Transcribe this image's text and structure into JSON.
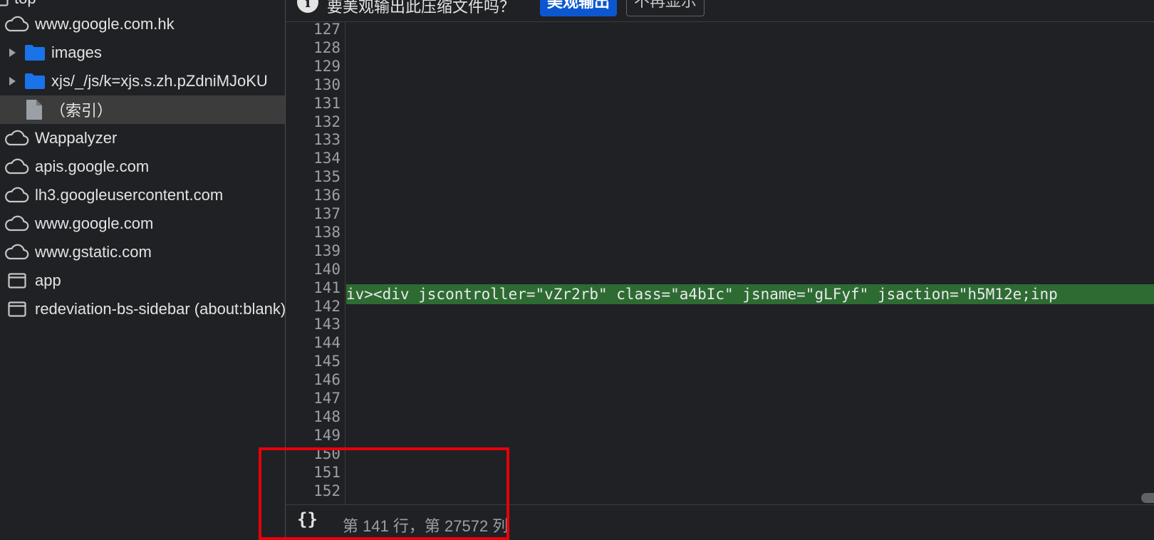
{
  "tree": {
    "top_label": "top",
    "items": [
      {
        "label": "www.google.com.hk",
        "icon": "cloud-icon"
      },
      {
        "label": "images",
        "icon": "folder-icon"
      },
      {
        "label": "xjs/_/js/k=xjs.s.zh.pZdniMJoKU",
        "icon": "folder-icon"
      },
      {
        "label": "（索引）",
        "icon": "file-icon"
      },
      {
        "label": "Wappalyzer",
        "icon": "cloud-icon"
      },
      {
        "label": "apis.google.com",
        "icon": "cloud-icon"
      },
      {
        "label": "lh3.googleusercontent.com",
        "icon": "cloud-icon"
      },
      {
        "label": "www.google.com",
        "icon": "cloud-icon"
      },
      {
        "label": "www.gstatic.com",
        "icon": "cloud-icon"
      },
      {
        "label": "app",
        "icon": "frame-icon"
      },
      {
        "label": "redeviation-bs-sidebar (about:blank)",
        "icon": "frame-icon"
      }
    ]
  },
  "infobar": {
    "message": "要美观输出此压缩文件吗？",
    "pretty_print_label": "美观输出",
    "never_show_label": "不再显示"
  },
  "editor": {
    "line_numbers": [
      "127",
      "128",
      "129",
      "130",
      "131",
      "132",
      "133",
      "134",
      "135",
      "136",
      "137",
      "138",
      "139",
      "140",
      "141",
      "142",
      "143",
      "144",
      "145",
      "146",
      "147",
      "148",
      "149",
      "150",
      "151",
      "152"
    ],
    "highlighted_line": "iv><div jscontroller=\"vZr2rb\" class=\"a4bIc\" jsname=\"gLFyf\" jsaction=\"h5M12e;inp"
  },
  "statusbar": {
    "pretty_print_symbol": "{}",
    "cursor_position": "第 141 行，第 27572 列"
  },
  "colors": {
    "background": "#202124",
    "highlight_line": "#2e6b32",
    "accent_button": "#0b57d0",
    "folder": "#1a73e8",
    "annotation_box": "#e8000b"
  }
}
